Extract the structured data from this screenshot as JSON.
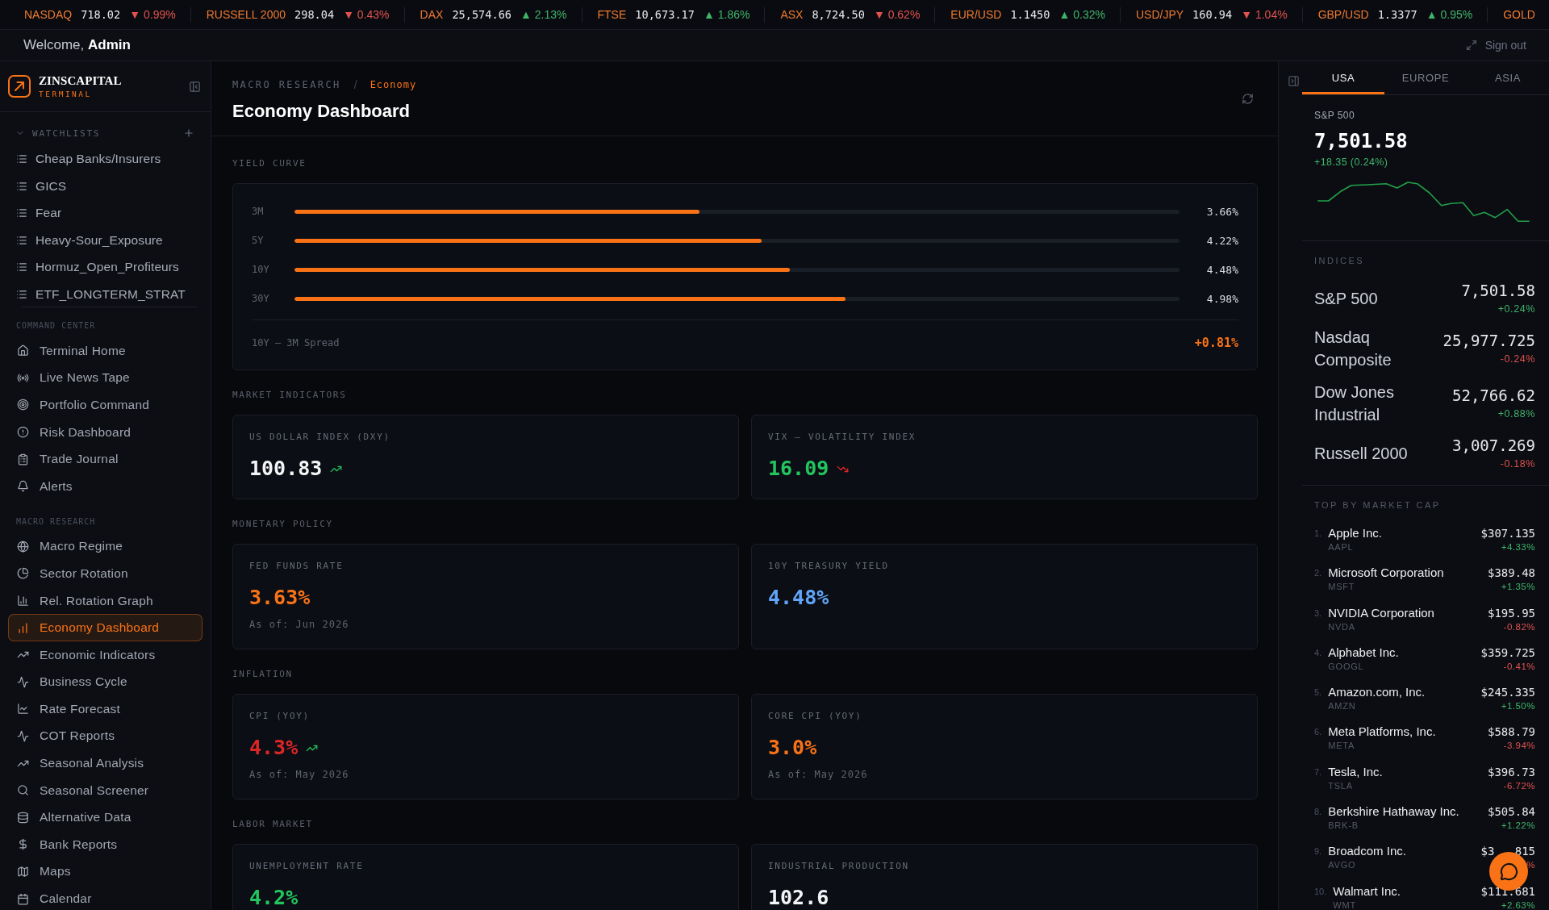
{
  "ticker": [
    {
      "symbol": "NASDAQ",
      "price": "718.02",
      "change": "▼ 0.99%",
      "rising": false
    },
    {
      "symbol": "RUSSELL 2000",
      "price": "298.04",
      "change": "▼ 0.43%",
      "rising": false
    },
    {
      "symbol": "DAX",
      "price": "25,574.66",
      "change": "▲ 2.13%",
      "rising": true
    },
    {
      "symbol": "FTSE",
      "price": "10,673.17",
      "change": "▲ 1.86%",
      "rising": true
    },
    {
      "symbol": "ASX",
      "price": "8,724.50",
      "change": "▼ 0.62%",
      "rising": false
    },
    {
      "symbol": "EUR/USD",
      "price": "1.1450",
      "change": "▲ 0.32%",
      "rising": true
    },
    {
      "symbol": "USD/JPY",
      "price": "160.94",
      "change": "▼ 1.04%",
      "rising": false
    },
    {
      "symbol": "GBP/USD",
      "price": "1.3377",
      "change": "▲ 0.95%",
      "rising": true
    },
    {
      "symbol": "GOLD"
    }
  ],
  "header": {
    "greeting": "Welcome, **Admin**",
    "sign_out": "Sign out"
  },
  "sidebar": {
    "brand": "ZINSCAPITAL",
    "tagline": "TERMINAL",
    "watchlists": {
      "title": "WATCHLISTS",
      "expanded": true,
      "items": [
        "Cheap Banks/Insurers",
        "GICS",
        "Fear",
        "Heavy-Sour_Exposure",
        "Hormuz_Open_Profiteurs",
        "ETF_LONGTERM_STRAT"
      ]
    },
    "sections": [
      {
        "title": "COMMAND CENTER",
        "items": [
          {
            "label": "Terminal Home",
            "selected": false
          },
          {
            "label": "Live News Tape",
            "selected": false
          },
          {
            "label": "Portfolio Command",
            "selected": false
          },
          {
            "label": "Risk Dashboard",
            "selected": false
          },
          {
            "label": "Trade Journal",
            "selected": false
          },
          {
            "label": "Alerts",
            "selected": false
          }
        ]
      },
      {
        "title": "MACRO RESEARCH",
        "items": [
          {
            "label": "Macro Regime",
            "selected": false
          },
          {
            "label": "Sector Rotation",
            "selected": false
          },
          {
            "label": "Rel. Rotation Graph",
            "selected": false
          },
          {
            "label": "Economy Dashboard",
            "selected": true
          },
          {
            "label": "Economic Indicators",
            "selected": false
          },
          {
            "label": "Business Cycle",
            "selected": false
          },
          {
            "label": "Rate Forecast",
            "selected": false
          },
          {
            "label": "COT Reports",
            "selected": false
          },
          {
            "label": "Seasonal Analysis",
            "selected": false
          },
          {
            "label": "Seasonal Screener",
            "selected": false
          },
          {
            "label": "Alternative Data",
            "selected": false
          },
          {
            "label": "Bank Reports",
            "selected": false
          },
          {
            "label": "Maps",
            "selected": false
          },
          {
            "label": "Calendar",
            "selected": false
          }
        ]
      }
    ]
  },
  "page": {
    "breadcrumb": {
      "parent": "MACRO RESEARCH",
      "separator": "/",
      "current": "Economy"
    },
    "title": "Economy Dashboard"
  },
  "yield_curve": {
    "title": "YIELD CURVE",
    "rows": [
      {
        "tenor": "3M",
        "level": 0.4575,
        "value": "3.66%"
      },
      {
        "tenor": "5Y",
        "level": 0.5275,
        "value": "4.22%"
      },
      {
        "tenor": "10Y",
        "level": 0.56,
        "value": "4.48%"
      },
      {
        "tenor": "30Y",
        "level": 0.6225,
        "value": "4.98%"
      }
    ],
    "spread": {
      "label": "10Y – 3M Spread",
      "value": "+0.81%"
    }
  },
  "sections": [
    {
      "title": "MARKET INDICATORS",
      "cards": [
        {
          "label": "US DOLLAR INDEX (DXY)",
          "value": "100.83",
          "color": "#f3f4f6",
          "trend_up": true,
          "trend_down": false
        },
        {
          "label": "VIX — VOLATILITY INDEX",
          "value": "16.09",
          "color": "#22c55e",
          "trend_up": false,
          "trend_down": true
        }
      ]
    },
    {
      "title": "MONETARY POLICY",
      "cards": [
        {
          "label": "FED FUNDS RATE",
          "value": "3.63%",
          "color": "#f97316",
          "trend_up": false,
          "trend_down": false,
          "as_of": "As of: Jun 2026"
        },
        {
          "label": "10Y TREASURY YIELD",
          "value": "4.48%",
          "color": "#60a5fa",
          "trend_up": false,
          "trend_down": false
        }
      ]
    },
    {
      "title": "INFLATION",
      "cards": [
        {
          "label": "CPI (YOY)",
          "value": "4.3%",
          "color": "#dc2626",
          "trend_up": true,
          "trend_down": false,
          "as_of": "As of: May 2026"
        },
        {
          "label": "CORE CPI (YOY)",
          "value": "3.0%",
          "color": "#f97316",
          "trend_up": false,
          "trend_down": false,
          "as_of": "As of: May 2026"
        }
      ]
    },
    {
      "title": "LABOR MARKET",
      "cards": [
        {
          "label": "UNEMPLOYMENT RATE",
          "value": "4.2%",
          "color": "#22c55e",
          "trend_up": false,
          "trend_down": false
        },
        {
          "label": "INDUSTRIAL PRODUCTION",
          "value": "102.6",
          "color": "#f3f4f6",
          "trend_up": false,
          "trend_down": false
        }
      ]
    }
  ],
  "right_panel": {
    "tabs": [
      {
        "label": "USA",
        "selected": true
      },
      {
        "label": "EUROPE",
        "selected": false
      },
      {
        "label": "ASIA",
        "selected": false
      }
    ],
    "featured": {
      "name": "S&P 500",
      "value": "7,501.58",
      "change": "+18.35 (0.24%)",
      "rising": true
    },
    "indices": {
      "title": "INDICES",
      "rows": [
        {
          "name": "S&P 500",
          "value": "7,501.58",
          "change": "+0.24%",
          "rising": true
        },
        {
          "name": "Nasdaq Composite",
          "value": "25,977.725",
          "change": "-0.24%",
          "rising": false
        },
        {
          "name": "Dow Jones Industrial",
          "value": "52,766.62",
          "change": "+0.88%",
          "rising": true
        },
        {
          "name": "Russell 2000",
          "value": "3,007.269",
          "change": "-0.18%",
          "rising": false
        }
      ]
    },
    "top_market_cap": {
      "title": "TOP BY MARKET CAP",
      "rows": [
        {
          "rank": "1.",
          "name": "Apple Inc.",
          "ticker": "AAPL",
          "price": "$307.135",
          "change": "+4.33%",
          "rising": true
        },
        {
          "rank": "2.",
          "name": "Microsoft Corporation",
          "ticker": "MSFT",
          "price": "$389.48",
          "change": "+1.35%",
          "rising": true
        },
        {
          "rank": "3.",
          "name": "NVIDIA Corporation",
          "ticker": "NVDA",
          "price": "$195.95",
          "change": "-0.82%",
          "rising": false
        },
        {
          "rank": "4.",
          "name": "Alphabet Inc.",
          "ticker": "GOOGL",
          "price": "$359.725",
          "change": "-0.41%",
          "rising": false
        },
        {
          "rank": "5.",
          "name": "Amazon.com, Inc.",
          "ticker": "AMZN",
          "price": "$245.335",
          "change": "+1.50%",
          "rising": true
        },
        {
          "rank": "6.",
          "name": "Meta Platforms, Inc.",
          "ticker": "META",
          "price": "$588.79",
          "change": "-3.94%",
          "rising": false
        },
        {
          "rank": "7.",
          "name": "Tesla, Inc.",
          "ticker": "TSLA",
          "price": "$396.73",
          "change": "-6.72%",
          "rising": false
        },
        {
          "rank": "8.",
          "name": "Berkshire Hathaway Inc.",
          "ticker": "BRK-B",
          "price": "$505.84",
          "change": "+1.22%",
          "rising": true
        },
        {
          "rank": "9.",
          "name": "Broadcom Inc.",
          "ticker": "AVGO",
          "price": "$3",
          "price_tail": "815",
          "change": "%",
          "rising": false
        },
        {
          "rank": "10.",
          "name": "Walmart Inc.",
          "ticker": "WMT",
          "price": "$111.681",
          "change": "+2.63%",
          "rising": true
        }
      ]
    }
  }
}
